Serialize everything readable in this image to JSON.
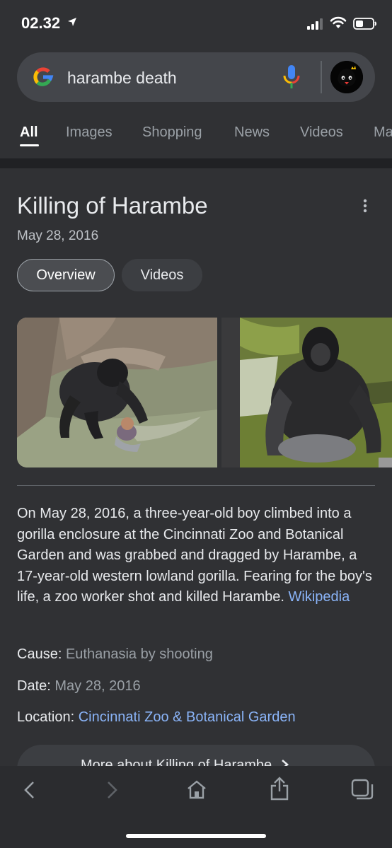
{
  "status_bar": {
    "time": "02.32"
  },
  "search": {
    "query": "harambe death"
  },
  "tabs": [
    {
      "label": "All"
    },
    {
      "label": "Images"
    },
    {
      "label": "Shopping"
    },
    {
      "label": "News"
    },
    {
      "label": "Videos"
    },
    {
      "label": "Ma"
    }
  ],
  "panel": {
    "title": "Killing of Harambe",
    "date": "May 28, 2016",
    "chips": [
      "Overview",
      "Videos"
    ],
    "description": "On May 28, 2016, a three-year-old boy climbed into a gorilla enclosure at the Cincinnati Zoo and Botanical Garden and was grabbed and dragged by Harambe, a 17-year-old western lowland gorilla. Fearing for the boy's life, a zoo worker shot and killed Harambe.",
    "source_link": "Wikipedia",
    "facts": [
      {
        "label": "Cause:",
        "value": "Euthanasia by shooting"
      },
      {
        "label": "Date:",
        "value": "May 28, 2016"
      },
      {
        "label": "Location:",
        "value": "Cincinnati Zoo & Botanical Garden"
      }
    ],
    "more_button": "More about Killing of Harambe"
  },
  "colors": {
    "background": "#303134",
    "link": "#8ab4f8",
    "text": "#e8eaed",
    "secondary_text": "#9aa0a6"
  },
  "icons": [
    "location-arrow-icon",
    "signal-icon",
    "wifi-icon",
    "battery-icon",
    "google-logo-icon",
    "mic-icon",
    "kebab-menu-icon",
    "chevron-right-icon",
    "back-icon",
    "forward-icon",
    "home-icon",
    "share-icon",
    "tabs-icon"
  ]
}
